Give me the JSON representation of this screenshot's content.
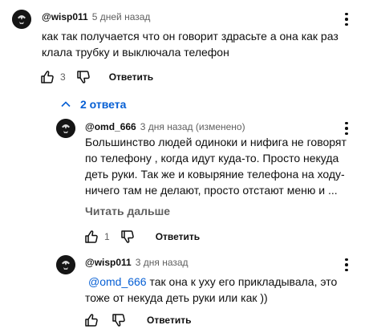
{
  "comment": {
    "author": "@wisp011",
    "time": "5 дней назад",
    "lines": [
      "как так получается что он говорит здрасьте а она как раз",
      "клала трубку и выключала телефон"
    ],
    "likes": "3",
    "reply_label": "Ответить"
  },
  "replies_toggle": {
    "label": "2 ответа",
    "icon": "chevron-up-icon"
  },
  "replies": [
    {
      "author": "@omd_666",
      "time": "3 дня назад (изменено)",
      "lines": [
        "Большинство людей одиноки и нифига не говорят",
        "по телефону , когда идут куда-то. Просто некуда",
        "деть руки. Так же и ковыряние телефона на ходу-",
        "ничего там не делают, просто отстают меню и ..."
      ],
      "read_more": "Читать дальше",
      "likes": "1",
      "reply_label": "Ответить"
    },
    {
      "author": "@wisp011",
      "time": "3 дня назад",
      "mention": "@omd_666",
      "line1_rest": " так она к уху его прикладывала, это",
      "line2": "тоже от некуда деть руки или как ))",
      "reply_label": "Ответить"
    }
  ],
  "colors": {
    "link": "#065fd4",
    "text": "#0f0f0f",
    "secondary": "#606060"
  }
}
